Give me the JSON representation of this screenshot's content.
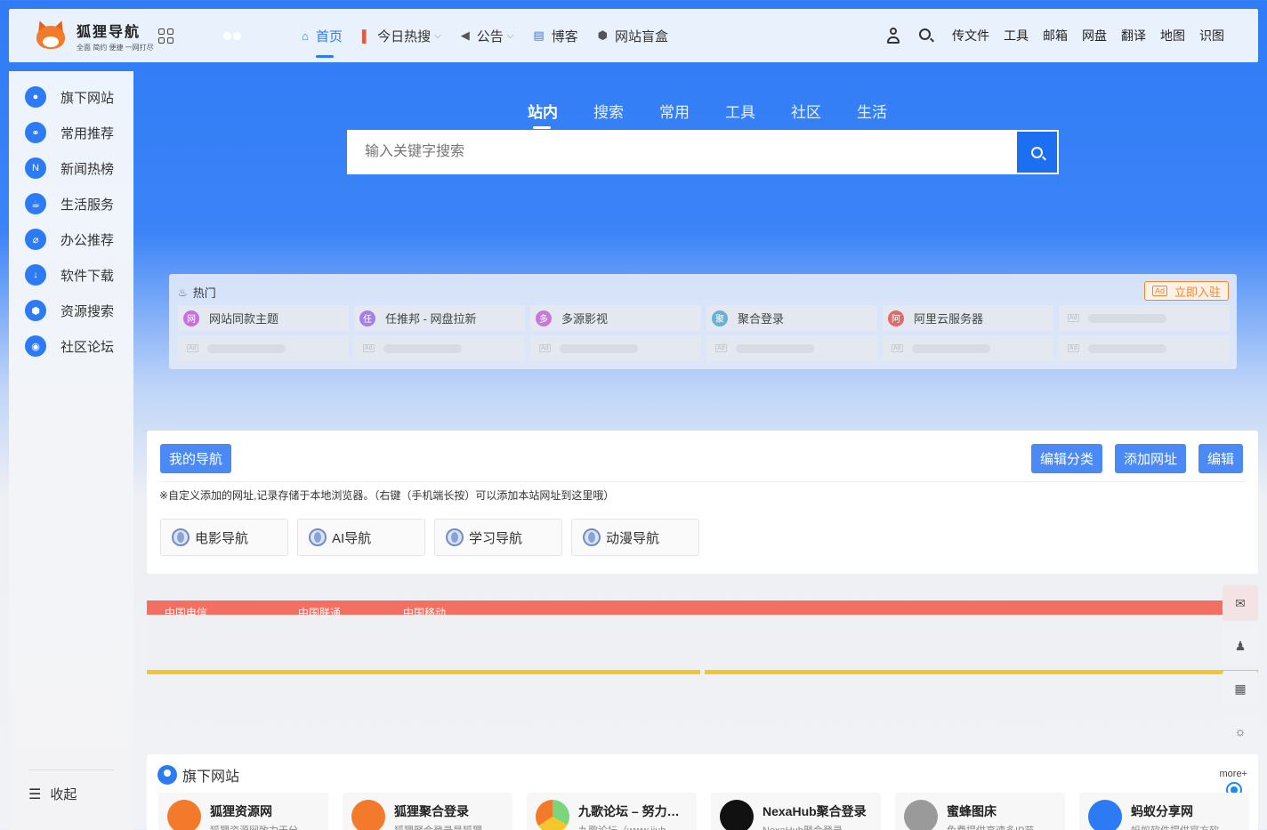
{
  "header": {
    "logo_title": "狐狸导航",
    "logo_sub": "全面 简约 便捷 一网打尽",
    "nav": [
      {
        "label": "首页",
        "icon": "home-icon"
      },
      {
        "label": "今日热搜",
        "icon": "chart-bars-icon"
      },
      {
        "label": "公告",
        "icon": "speaker-icon"
      },
      {
        "label": "博客",
        "icon": "document-icon"
      },
      {
        "label": "网站盲盒",
        "icon": "box-icon"
      }
    ],
    "tools": [
      "传文件",
      "工具",
      "邮箱",
      "网盘",
      "翻译",
      "地图",
      "识图"
    ]
  },
  "sidebar": {
    "items": [
      {
        "label": "旗下网站",
        "icon": "pin-icon"
      },
      {
        "label": "常用推荐",
        "icon": "link-icon"
      },
      {
        "label": "新闻热榜",
        "icon": "news-icon"
      },
      {
        "label": "生活服务",
        "icon": "coffee-icon"
      },
      {
        "label": "办公推荐",
        "icon": "clip-icon"
      },
      {
        "label": "软件下载",
        "icon": "download-icon"
      },
      {
        "label": "资源搜索",
        "icon": "cube-icon"
      },
      {
        "label": "社区论坛",
        "icon": "planet-icon"
      }
    ],
    "collapse_label": "收起"
  },
  "search": {
    "tabs": [
      "站内",
      "搜索",
      "常用",
      "工具",
      "社区",
      "生活"
    ],
    "placeholder": "输入关键字搜索"
  },
  "hot": {
    "title": "热门",
    "join_label": "立即入驻",
    "items": [
      {
        "badge": "网",
        "label": "网站同款主题",
        "color": "#c86ee0"
      },
      {
        "badge": "任",
        "label": "任推邦 - 网盘拉新",
        "color": "#a77ee6"
      },
      {
        "badge": "多",
        "label": "多源影视",
        "color": "#c67ad6"
      },
      {
        "badge": "聚",
        "label": "聚合登录",
        "color": "#6ab0d0"
      },
      {
        "badge": "阿",
        "label": "阿里云服务器",
        "color": "#e06a6a"
      }
    ],
    "ad_tag": "Ad"
  },
  "mynav": {
    "title": "我的导航",
    "edit_category": "编辑分类",
    "add_site": "添加网址",
    "edit": "编辑",
    "note": "※自定义添加的网址,记录存储于本地浏览器。（右键（手机端长按）可以添加本站网址到这里哦）",
    "cards": [
      "电影导航",
      "AI导航",
      "学习导航",
      "动漫导航"
    ]
  },
  "banner": {
    "text1": "中国电信",
    "text2": "中国联通",
    "text3": "中国移动"
  },
  "sites": {
    "title": "旗下网站",
    "more": "more+",
    "cards": [
      {
        "name": "狐狸资源网",
        "desc": "狐狸资源网致力于分",
        "color": "#f27a2a"
      },
      {
        "name": "狐狸聚合登录",
        "desc": "狐狸聚合登录是狐狸",
        "color": "#f27a2a"
      },
      {
        "name": "九歌论坛 – 努力…",
        "desc": "九歌论坛（www.jiuh",
        "color": "#7bd67b"
      },
      {
        "name": "NexaHub聚合登录",
        "desc": "NexaHub聚合登录",
        "color": "#111111"
      },
      {
        "name": "蜜蜂图床",
        "desc": "免费提供高速多IP节",
        "color": "#9a9a9a"
      },
      {
        "name": "蚂蚁分享网",
        "desc": "蚂蚁软件提供官方软",
        "color": "#2c7bf5"
      }
    ]
  },
  "colors": {
    "accent": "#2c7bf5",
    "button": "#4b8af5"
  }
}
